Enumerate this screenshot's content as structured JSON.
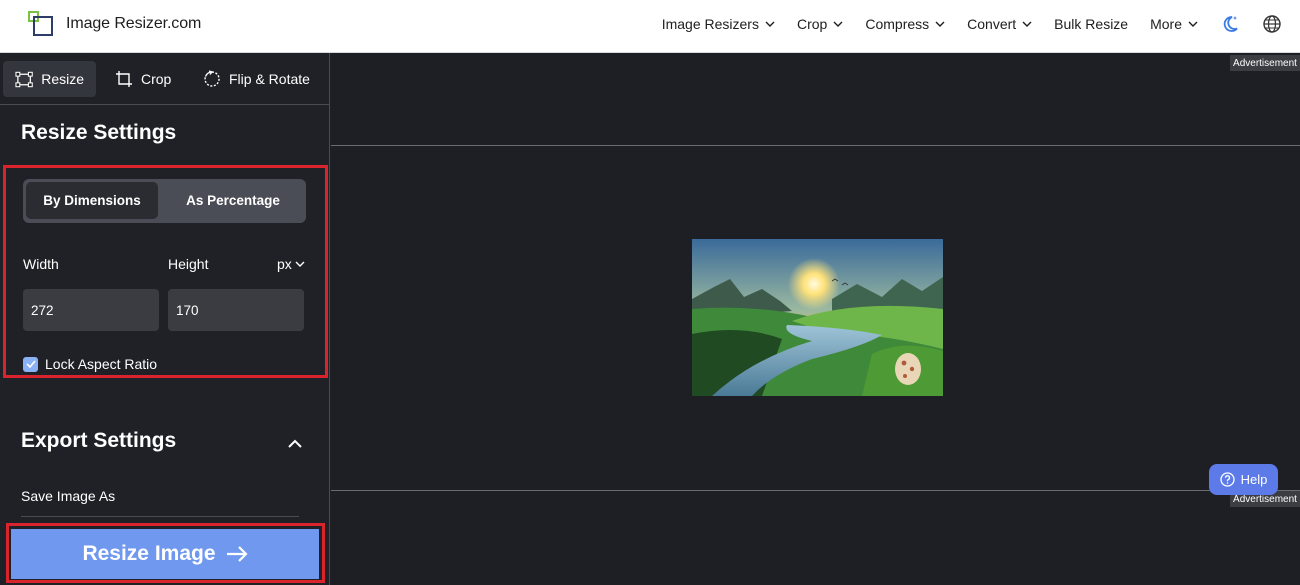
{
  "brand": {
    "name": "Image Resizer.com"
  },
  "nav": {
    "items": [
      {
        "label": "Image Resizers",
        "dropdown": true
      },
      {
        "label": "Crop",
        "dropdown": true
      },
      {
        "label": "Compress",
        "dropdown": true
      },
      {
        "label": "Convert",
        "dropdown": true
      },
      {
        "label": "Bulk Resize",
        "dropdown": false
      },
      {
        "label": "More",
        "dropdown": true
      }
    ],
    "icons": [
      "theme-toggle-icon",
      "globe-icon"
    ]
  },
  "tools": {
    "tabs": [
      {
        "label": "Resize",
        "icon": "resize-icon",
        "active": true
      },
      {
        "label": "Crop",
        "icon": "crop-icon",
        "active": false
      },
      {
        "label": "Flip & Rotate",
        "icon": "rotate-icon",
        "active": false
      }
    ]
  },
  "resize_settings": {
    "title": "Resize Settings",
    "modes": [
      "By Dimensions",
      "As Percentage"
    ],
    "active_mode": "By Dimensions",
    "width_label": "Width",
    "height_label": "Height",
    "unit": "px",
    "width_value": "272",
    "height_value": "170",
    "lock_label": "Lock Aspect Ratio",
    "lock_checked": true
  },
  "export_settings": {
    "title": "Export Settings",
    "save_as_label": "Save Image As"
  },
  "action": {
    "resize_label": "Resize Image"
  },
  "ads": {
    "label": "Advertisement"
  },
  "help": {
    "label": "Help"
  },
  "colors": {
    "accent": "#6f98ee",
    "highlight": "#d9232d",
    "help": "#5d7be8",
    "background": "#1d1f25"
  }
}
